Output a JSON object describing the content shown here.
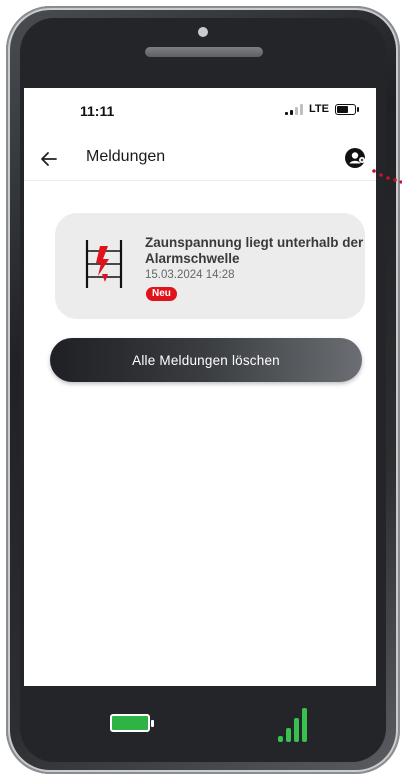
{
  "status_bar": {
    "time": "11:11",
    "network": "LTE"
  },
  "app_bar": {
    "title": "Meldungen",
    "back_icon": "arrow-left-icon",
    "profile_icon": "user-profile-icon"
  },
  "notifications": [
    {
      "title": "Zaunspannung liegt unterhalb der Alarmschwelle",
      "date": "15.03.2024 14:28",
      "badge": "Neu",
      "icon": "fence-voltage-alarm-icon"
    }
  ],
  "actions": {
    "delete_all_label": "Alle Meldungen löschen"
  },
  "device_status": {
    "battery_icon": "battery-full-icon",
    "signal_icon": "signal-strength-icon"
  },
  "colors": {
    "accent_red": "#e1121b",
    "battery_green": "#2fb344",
    "signal_green": "#39c150",
    "card_bg": "#ececec"
  }
}
